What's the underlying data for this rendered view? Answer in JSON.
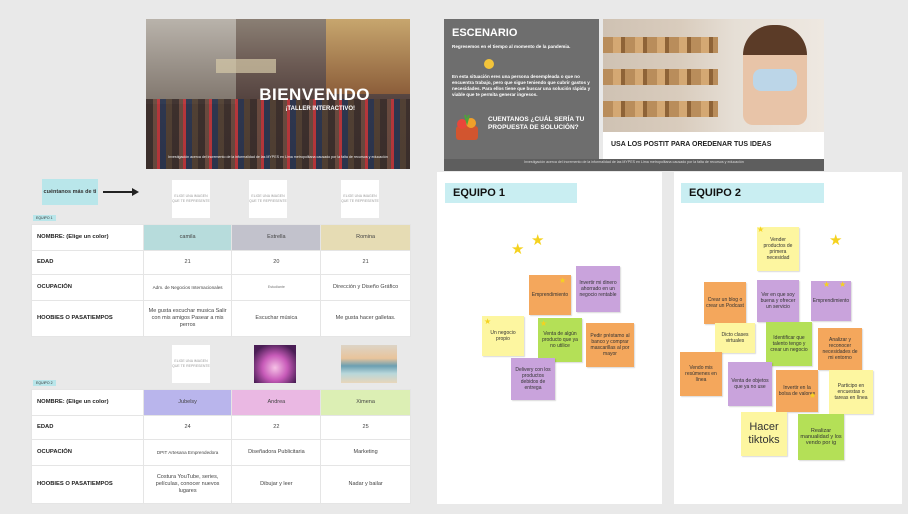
{
  "hero": {
    "title": "BIENVENIDO",
    "subtitle": "¡TALLER INTERACTIVO!",
    "footnote": "Investigación acerca del incremento de la informalidad de las MYPES en Lima metropolitana causado por la falta de recursos y educación"
  },
  "left": {
    "cue_label": "cuéntanos más de ti",
    "photo_placeholder": "ELIGE UNA IMAGEN QUE TE REPRESENTE",
    "team1_tag": "EQUIPO 1",
    "team2_tag": "EQUIPO 2",
    "row_labels": {
      "name": "NOMBRE: (Elige un color)",
      "age": "EDAD",
      "occupation": "OCUPACIÓN",
      "hobbies": "HOOBIES O PASATIEMPOS"
    },
    "team1": [
      {
        "name": "camila",
        "age": "21",
        "occupation": "Adm. de Negocios Internacionales",
        "hobbies": "Me gusta escuchar musica Salir con mis amigos Pasear a mis perros",
        "color": "#b7dcdc"
      },
      {
        "name": "Estrella",
        "age": "20",
        "occupation": "Estudiante",
        "hobbies": "Escuchar música",
        "color": "#c2c2cc"
      },
      {
        "name": "Romina",
        "age": "21",
        "occupation": "Dirección y Diseño Gráfico",
        "hobbies": "Me gusta hacer galletas.",
        "color": "#e6dcb4"
      }
    ],
    "team2": [
      {
        "name": "Jubelsy",
        "age": "24",
        "occupation": "DPIT Artesana Emprendedora",
        "hobbies": "Costura YouTube, series, películas, conocer nuevos lugares",
        "color": "#b9b5ec"
      },
      {
        "name": "Andrea",
        "age": "22",
        "occupation": "Diseñadora Publicitaria",
        "hobbies": "Dibujar y leer",
        "color": "#eab8e3"
      },
      {
        "name": "Ximena",
        "age": "25",
        "occupation": "Marketing",
        "hobbies": "Nadar y bailar",
        "color": "#dcefb4"
      }
    ]
  },
  "escenario": {
    "heading": "ESCENARIO",
    "p1": "Regresemos en el tiempo al momento de la pandemia.",
    "p2": "En esta situación eres una persona desempleada o que no encuentra trabajo, pero que sigue teniendo que cubrir gastos y necesidades. Para ellos tiene que buscar una solución rápida y viable que te permita generar ingresos.",
    "question": "CUENTANOS ¿CUÁL SERÍA TU PROPUESTA DE SOLUCIÓN?",
    "footnote": "Investigación acerca del incremento de la informalidad de las MYPES en Lima metropolitana causado por la falta de recursos y educación"
  },
  "baker": {
    "caption": "USA LOS POSTIT PARA OREDENAR TUS IDEAS"
  },
  "team1": {
    "title": "EQUIPO 1",
    "notes": [
      {
        "text": "Emprendimiento",
        "color": "o"
      },
      {
        "text": "Invertir mi dinero ahorrado en un negocio rentable",
        "color": "p"
      },
      {
        "text": "Un negocio propio",
        "color": "y"
      },
      {
        "text": "Venta de algún producto que ya no utilice",
        "color": "g"
      },
      {
        "text": "Pedir préstamo al banco y comprar mascarillas al por mayor",
        "color": "o"
      },
      {
        "text": "Delivery con los productos debidos de entrega",
        "color": "p"
      }
    ]
  },
  "team2": {
    "title": "EQUIPO 2",
    "notes": [
      {
        "text": "Vender productos de primera necesidad",
        "color": "y"
      },
      {
        "text": "Crear un blog o crear un Podcast",
        "color": "o"
      },
      {
        "text": "Ver en que soy buena y ofrecer un servicio",
        "color": "p"
      },
      {
        "text": "Emprendimiento",
        "color": "p"
      },
      {
        "text": "Dicto clases virtuales",
        "color": "y"
      },
      {
        "text": "Identificar que talento tengo y crear un negocio",
        "color": "o"
      },
      {
        "text": "Analizar y reconocer necesidades de mi entorno",
        "color": "o"
      },
      {
        "text": "Vendo mis resúmenes en línea",
        "color": "o"
      },
      {
        "text": "Venta de objetos que ya no use",
        "color": "p"
      },
      {
        "text": "Invertir en la bolsa de valores",
        "color": "o"
      },
      {
        "text": "Participo en encuestas o tareas en línea",
        "color": "y"
      },
      {
        "text": "Hacer tiktoks",
        "color": "y"
      },
      {
        "text": "Realizar manualidad y los vendo por ig",
        "color": "g"
      }
    ]
  }
}
